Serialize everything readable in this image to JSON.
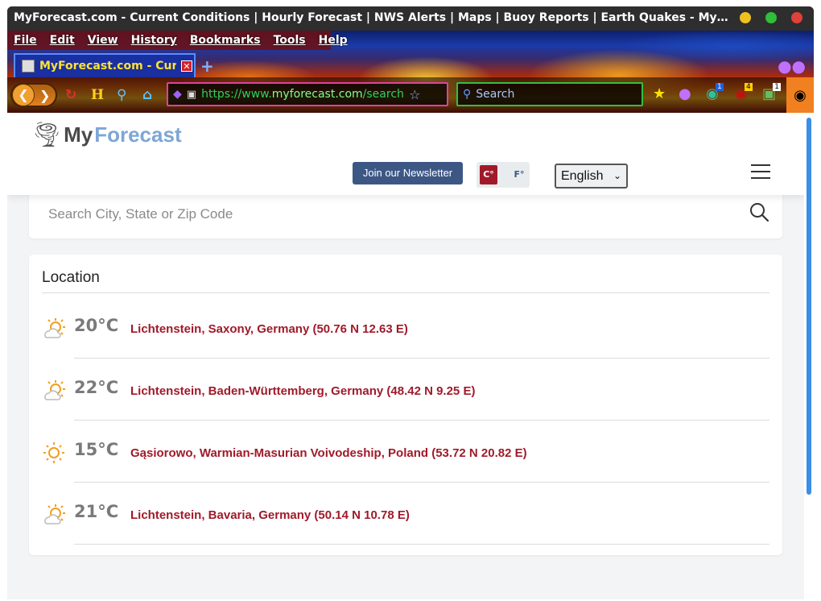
{
  "window": {
    "title": "MyForecast.com - Current Conditions | Hourly Forecast | NWS Alerts | Maps | Buoy Reports | Earth Quakes - MyForecast — ...",
    "colors": {
      "close": "#e0413a",
      "maximize": "#2fbf3a",
      "minimize": "#f0c020"
    }
  },
  "menu": [
    "File",
    "Edit",
    "View",
    "History",
    "Bookmarks",
    "Tools",
    "Help"
  ],
  "tab": {
    "title": "MyForecast.com - Curren",
    "close_glyph": "✕",
    "new_tab_glyph": "+"
  },
  "nav": {
    "url_prefix": "https://www.",
    "url_host": "myforecast.com",
    "url_rest": "/search",
    "search_placeholder": "Search",
    "badges": {
      "ext1": "1",
      "ext2": "4",
      "ext3": "1"
    }
  },
  "site": {
    "logo_my": "My",
    "logo_forecast": "Forecast",
    "newsletter_label": "Join our Newsletter",
    "unit_c": "C°",
    "unit_f": "F°",
    "language": "English",
    "search_placeholder": "Search City, State or Zip Code"
  },
  "locations": {
    "heading": "Location",
    "items": [
      {
        "temp": "20°C",
        "place": "Lichtenstein, Saxony, Germany (50.76 N 12.63 E)",
        "icon": "partly-sunny-icon"
      },
      {
        "temp": "22°C",
        "place": "Lichtenstein, Baden-Württemberg, Germany (48.42 N 9.25 E)",
        "icon": "partly-sunny-icon"
      },
      {
        "temp": "15°C",
        "place": "Gąsiorowo, Warmian-Masurian Voivodeship, Poland (53.72 N 20.82 E)",
        "icon": "sunny-icon"
      },
      {
        "temp": "21°C",
        "place": "Lichtenstein, Bavaria, Germany (50.14 N 10.78 E)",
        "icon": "partly-sunny-icon"
      }
    ]
  },
  "colors": {
    "accent_red": "#a01a2a",
    "navy": "#3d5785",
    "logo_blue": "#7ea6d6"
  }
}
